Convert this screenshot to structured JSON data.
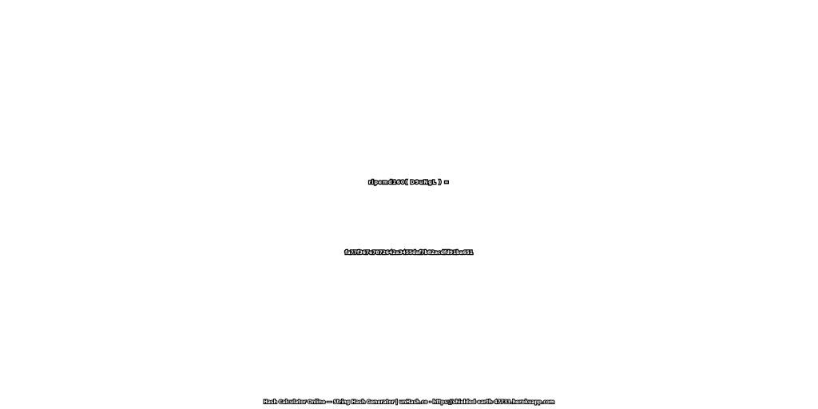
{
  "expression": "ripemd160( D9uNgL ) =",
  "hash_value": "fa77f367e7872642a3455daf7b82acdfd91ba651",
  "footer": "Hash Calculator Online — String Hash Generator | unHash.co - https://shielded-earth-47733.herokuapp.com",
  "colors": {
    "background": "#ffffff",
    "text_fill": "#ffffff",
    "text_outline": "#000000"
  }
}
